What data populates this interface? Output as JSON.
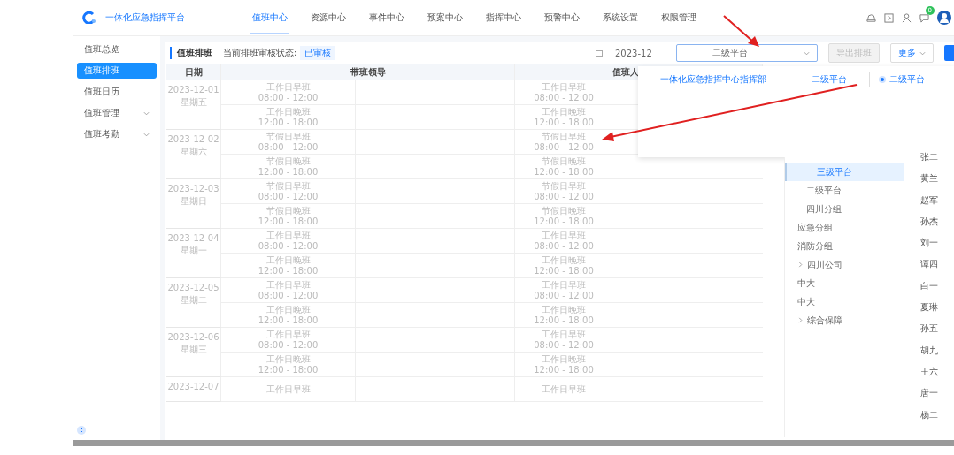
{
  "header": {
    "logo_text": "一体化应急指挥平台",
    "nav": [
      {
        "label": "值班中心",
        "selected": true
      },
      {
        "label": "资源中心",
        "selected": false
      },
      {
        "label": "事件中心",
        "selected": false
      },
      {
        "label": "预案中心",
        "selected": false
      },
      {
        "label": "指挥中心",
        "selected": false
      },
      {
        "label": "预警中心",
        "selected": false
      },
      {
        "label": "系统设置",
        "selected": false
      },
      {
        "label": "权限管理",
        "selected": false
      }
    ],
    "badge": "0"
  },
  "sidebar": {
    "items": [
      {
        "label": "值班总览",
        "selected": false,
        "expandable": false
      },
      {
        "label": "值班排班",
        "selected": true,
        "expandable": false
      },
      {
        "label": "值班日历",
        "selected": false,
        "expandable": false
      },
      {
        "label": "值班管理",
        "selected": false,
        "expandable": true
      },
      {
        "label": "值班考勤",
        "selected": false,
        "expandable": true
      }
    ]
  },
  "panel": {
    "title": "值班排班",
    "status_label": "当前排班审核状态:",
    "status_tag": "已审核",
    "month": "2023-12",
    "platform_select": "二级平台",
    "buttons": [
      {
        "label": "导出排班",
        "disabled": true
      },
      {
        "label": "更多",
        "disabled": false
      }
    ]
  },
  "table": {
    "columns": [
      "日期",
      "带班领导",
      "值班人"
    ],
    "rows": [
      {
        "date": "2023-12-01",
        "weekday": "星期五",
        "shifts": [
          {
            "leader": [
              "工作日早班",
              "08:00 - 12:00"
            ],
            "duty": [
              "工作日早班",
              "08:00 - 12:00"
            ]
          },
          {
            "leader": [
              "工作日晚班",
              "12:00 - 18:00"
            ],
            "duty": [
              "工作日晚班",
              "12:00 - 18:00"
            ]
          }
        ]
      },
      {
        "date": "2023-12-02",
        "weekday": "星期六",
        "shifts": [
          {
            "leader": [
              "节假日早班",
              "08:00 - 12:00"
            ],
            "duty": [
              "节假日早班",
              "08:00 - 12:00"
            ]
          },
          {
            "leader": [
              "节假日晚班",
              "12:00 - 18:00"
            ],
            "duty": [
              "节假日晚班",
              "12:00 - 18:00"
            ]
          }
        ]
      },
      {
        "date": "2023-12-03",
        "weekday": "星期日",
        "shifts": [
          {
            "leader": [
              "节假日早班",
              "08:00 - 12:00"
            ],
            "duty": [
              "节假日早班",
              "08:00 - 12:00"
            ]
          },
          {
            "leader": [
              "节假日晚班",
              "12:00 - 18:00"
            ],
            "duty": [
              "节假日晚班",
              "12:00 - 18:00"
            ]
          }
        ]
      },
      {
        "date": "2023-12-04",
        "weekday": "星期一",
        "shifts": [
          {
            "leader": [
              "工作日早班",
              "08:00 - 12:00"
            ],
            "duty": [
              "工作日早班",
              "08:00 - 12:00"
            ]
          },
          {
            "leader": [
              "工作日晚班",
              "12:00 - 18:00"
            ],
            "duty": [
              "工作日晚班",
              "12:00 - 18:00"
            ]
          }
        ]
      },
      {
        "date": "2023-12-05",
        "weekday": "星期二",
        "shifts": [
          {
            "leader": [
              "工作日早班",
              "08:00 - 12:00"
            ],
            "duty": [
              "工作日早班",
              "08:00 - 12:00"
            ]
          },
          {
            "leader": [
              "工作日晚班",
              "12:00 - 18:00"
            ],
            "duty": [
              "工作日晚班",
              "12:00 - 18:00"
            ]
          }
        ]
      },
      {
        "date": "2023-12-06",
        "weekday": "星期三",
        "shifts": [
          {
            "leader": [
              "工作日早班",
              "08:00 - 12:00"
            ],
            "duty": [
              "工作日早班",
              "08:00 - 12:00"
            ]
          },
          {
            "leader": [
              "工作日晚班",
              "12:00 - 18:00"
            ],
            "duty": [
              "工作日晚班",
              "12:00 - 18:00"
            ]
          }
        ]
      },
      {
        "date": "2023-12-07",
        "weekday": "",
        "shifts": [
          {
            "leader": [
              "工作日早班"
            ],
            "duty": [
              "工作日早班"
            ]
          }
        ]
      }
    ]
  },
  "cascader": {
    "tabs": [
      {
        "label": "一体化应急指挥中心指挥部",
        "selected": false
      },
      {
        "label": "二级平台",
        "selected": false
      },
      {
        "label": "二级平台",
        "selected": true
      }
    ],
    "options": [
      {
        "label": "三级平台",
        "selected": true,
        "expandable": false,
        "indent": true
      },
      {
        "label": "二级平台",
        "selected": false,
        "expandable": false,
        "indent": true
      },
      {
        "label": "四川分组",
        "selected": false,
        "expandable": false,
        "indent": true
      },
      {
        "label": "应急分组",
        "selected": false,
        "expandable": false,
        "indent": false
      },
      {
        "label": "消防分组",
        "selected": false,
        "expandable": false,
        "indent": false
      },
      {
        "label": "四川公司",
        "selected": false,
        "expandable": true,
        "indent": false
      },
      {
        "label": "中大",
        "selected": false,
        "expandable": false,
        "indent": false
      },
      {
        "label": "中大",
        "selected": false,
        "expandable": false,
        "indent": false
      },
      {
        "label": "综合保障",
        "selected": false,
        "expandable": true,
        "indent": false
      }
    ],
    "names": [
      "张二",
      "黄兰",
      "赵军",
      "孙杰",
      "刘一",
      "谭四",
      "白一",
      "夏琳",
      "孙五",
      "胡九",
      "王六",
      "唐一",
      "杨二"
    ]
  }
}
